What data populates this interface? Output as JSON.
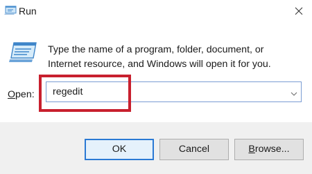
{
  "window": {
    "title": "Run",
    "close_icon": "close-icon",
    "app_icon": "run-dialog-icon"
  },
  "body": {
    "description_line1": "Type the name of a program, folder, document, or",
    "description_line2": "Internet resource, and Windows will open it for you.",
    "open_label_underlined": "O",
    "open_label_rest": "pen:",
    "input_value": "regedit",
    "highlight_color": "#c8202e"
  },
  "buttons": {
    "ok": "OK",
    "cancel": "Cancel",
    "browse_underlined": "B",
    "browse_rest": "rowse..."
  }
}
